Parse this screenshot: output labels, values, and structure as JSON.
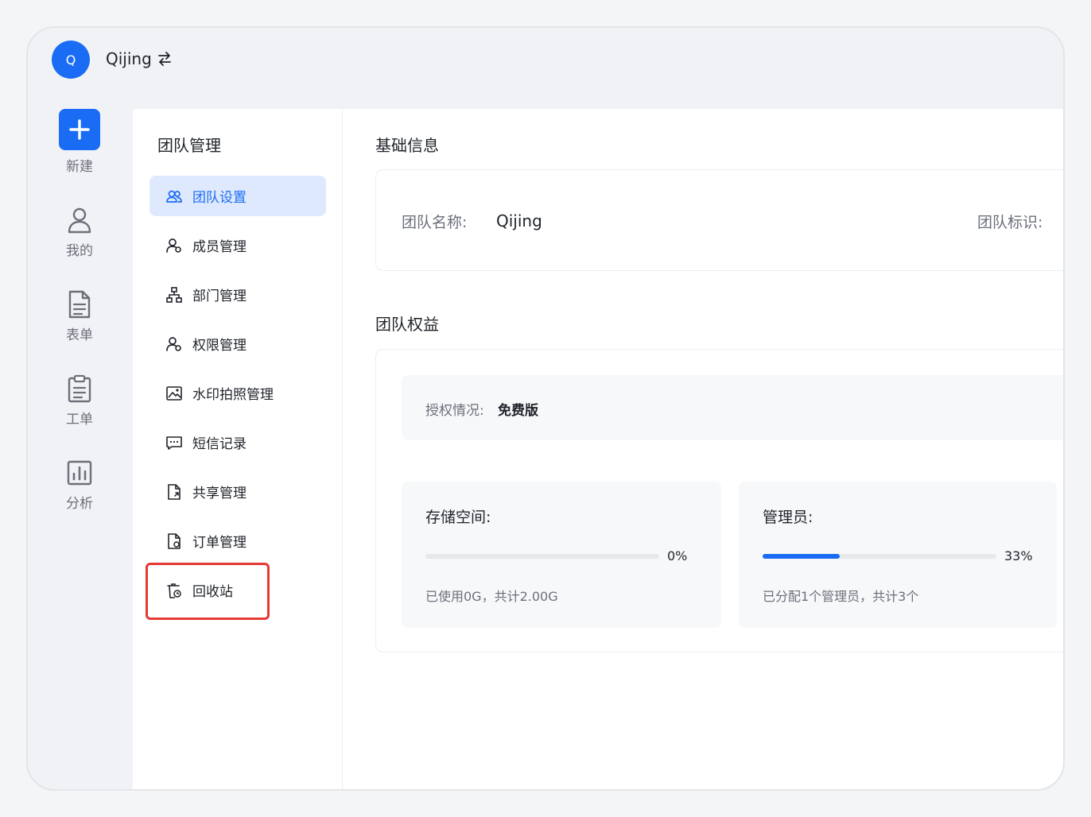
{
  "header": {
    "avatar_letter": "Q",
    "team_name": "Qijing",
    "switch_icon": "swap-icon"
  },
  "rail": {
    "items": [
      {
        "label": "新建",
        "icon": "plus-icon"
      },
      {
        "label": "我的",
        "icon": "user-icon"
      },
      {
        "label": "表单",
        "icon": "document-icon"
      },
      {
        "label": "工单",
        "icon": "clipboard-icon"
      },
      {
        "label": "分析",
        "icon": "bar-chart-icon"
      }
    ]
  },
  "subnav": {
    "title": "团队管理",
    "items": [
      {
        "label": "团队设置",
        "icon": "team-icon",
        "active": true
      },
      {
        "label": "成员管理",
        "icon": "member-icon"
      },
      {
        "label": "部门管理",
        "icon": "org-tree-icon"
      },
      {
        "label": "权限管理",
        "icon": "permission-icon"
      },
      {
        "label": "水印拍照管理",
        "icon": "watermark-photo-icon"
      },
      {
        "label": "短信记录",
        "icon": "sms-icon"
      },
      {
        "label": "共享管理",
        "icon": "share-file-icon"
      },
      {
        "label": "订单管理",
        "icon": "order-file-icon"
      },
      {
        "label": "回收站",
        "icon": "recycle-bin-icon"
      }
    ]
  },
  "main": {
    "basic_info": {
      "title": "基础信息",
      "name_label": "团队名称:",
      "name_value": "Qijing",
      "id_label": "团队标识:"
    },
    "benefits": {
      "title": "团队权益",
      "license_label": "授权情况:",
      "license_value": "免费版",
      "storage": {
        "title": "存储空间:",
        "percent_text": "0%",
        "percent": 0,
        "desc": "已使用0G，共计2.00G"
      },
      "admins": {
        "title": "管理员:",
        "percent_text": "33%",
        "percent": 33,
        "desc": "已分配1个管理员，共计3个"
      }
    }
  },
  "colors": {
    "accent": "#1a6cf5",
    "highlight": "#e53935"
  }
}
